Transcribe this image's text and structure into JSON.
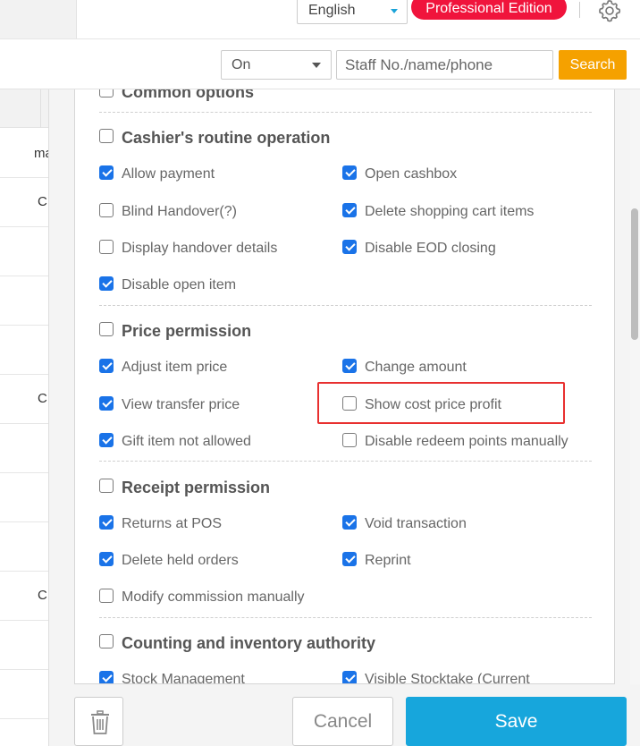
{
  "header": {
    "language": "English",
    "edition_badge": "Professional Edition",
    "icons": {
      "gear": "gear-icon",
      "caret": "caret-down-icon"
    },
    "colors": {
      "edition_badge": "#f0143c",
      "caret": "#1aa3d8"
    }
  },
  "filters": {
    "status_value": "On",
    "search_placeholder": "Staff No./name/phone",
    "search_button": "Search",
    "search_button_color": "#f5a100"
  },
  "table": {
    "column_header_partial": "ma",
    "cells": [
      "C",
      "C",
      "C"
    ]
  },
  "permissions": {
    "groups": [
      {
        "label": "Common options",
        "checked": false
      },
      {
        "label": "Cashier's routine operation",
        "checked": false
      },
      {
        "label": "Price permission",
        "checked": false
      },
      {
        "label": "Receipt permission",
        "checked": false
      },
      {
        "label": "Counting and inventory authority",
        "checked": false
      }
    ],
    "options": [
      {
        "label": "Allow payment",
        "checked": true
      },
      {
        "label": "Open cashbox",
        "checked": true
      },
      {
        "label": "Blind Handover(?)",
        "checked": false
      },
      {
        "label": "Delete shopping cart items",
        "checked": true
      },
      {
        "label": "Display handover details",
        "checked": false
      },
      {
        "label": "Disable EOD closing",
        "checked": true
      },
      {
        "label": "Disable open item",
        "checked": true
      },
      {
        "label": "Adjust item price",
        "checked": true
      },
      {
        "label": "Change amount",
        "checked": true
      },
      {
        "label": "View transfer price",
        "checked": true
      },
      {
        "label": "Show cost price profit",
        "checked": false
      },
      {
        "label": "Gift item not allowed",
        "checked": true
      },
      {
        "label": "Disable redeem points manually",
        "checked": false
      },
      {
        "label": "Returns at POS",
        "checked": true
      },
      {
        "label": "Void transaction",
        "checked": true
      },
      {
        "label": "Delete held orders",
        "checked": true
      },
      {
        "label": "Reprint",
        "checked": true
      },
      {
        "label": "Modify commission manually",
        "checked": false
      },
      {
        "label": "Stock Management",
        "checked": true
      },
      {
        "label": "Visible Stocktake (Current",
        "checked": true
      }
    ],
    "checkbox_color": "#1a73e8",
    "highlight_color": "#e8302f"
  },
  "footer": {
    "cancel": "Cancel",
    "save": "Save",
    "save_color": "#17a6dc",
    "delete_icon": "trash-icon"
  }
}
